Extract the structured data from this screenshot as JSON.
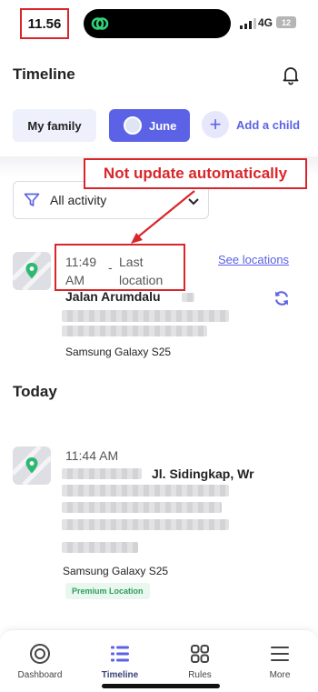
{
  "status_bar": {
    "time": "11.56",
    "network": "4G",
    "battery": "12"
  },
  "header": {
    "title": "Timeline"
  },
  "family_chips": {
    "family_label": "My family",
    "child_name": "June",
    "add_child_label": "Add a child"
  },
  "annotation": {
    "text": "Not update automatically",
    "color": "#d9262b"
  },
  "filter": {
    "label": "All activity"
  },
  "entries": [
    {
      "time": "11:49 AM",
      "separator": "-",
      "label": "Last location",
      "link": "See locations",
      "address": "Jalan Arumdalu",
      "device": "Samsung Galaxy S25"
    }
  ],
  "today": {
    "heading": "Today",
    "entries": [
      {
        "time": "11:44 AM",
        "address": "Jl. Sidingkap, Wr",
        "device": "Samsung Galaxy S25",
        "badge": "Premium Location"
      }
    ]
  },
  "nav": {
    "items": [
      {
        "label": "Dashboard",
        "icon": "target-icon"
      },
      {
        "label": "Timeline",
        "icon": "list-icon",
        "active": true
      },
      {
        "label": "Rules",
        "icon": "grid-icon"
      },
      {
        "label": "More",
        "icon": "menu-icon"
      }
    ]
  },
  "colors": {
    "accent": "#5b62e6",
    "annotation": "#d9262b",
    "premium": "#2f9e5b",
    "map_pin": "#2eb872"
  }
}
